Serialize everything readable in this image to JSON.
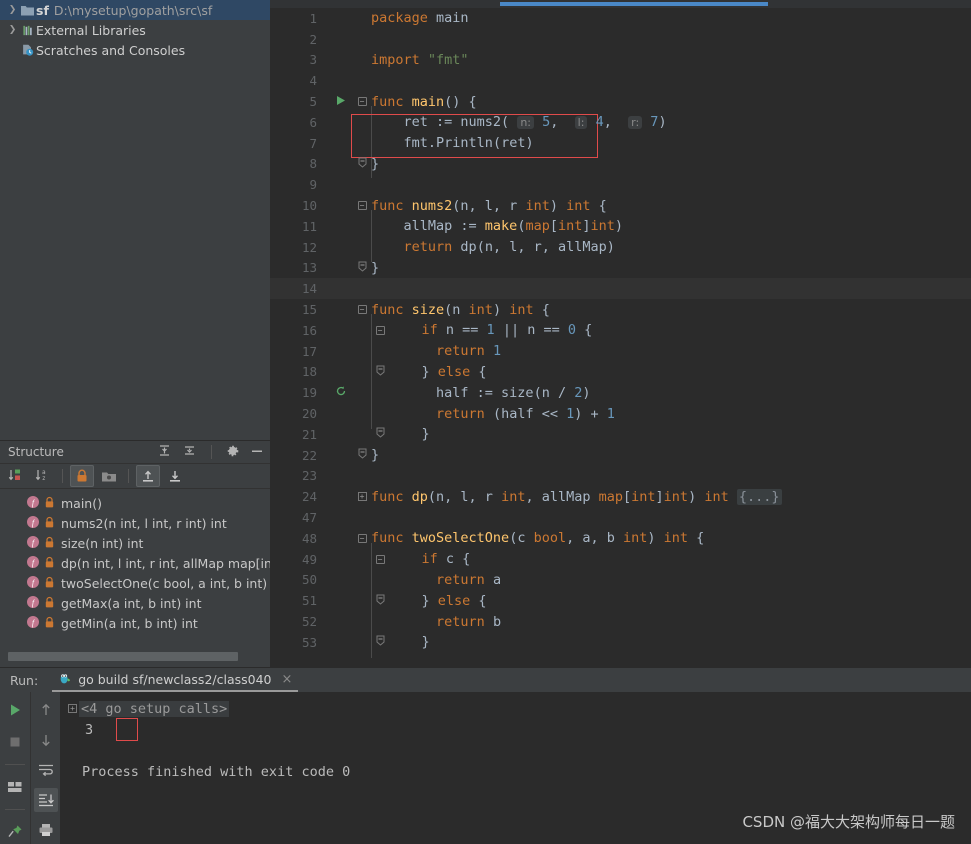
{
  "project": {
    "items": [
      {
        "arrow": "❯",
        "icon": "folder-icon",
        "name": "sf",
        "path": "D:\\mysetup\\gopath\\src\\sf",
        "selected": true
      },
      {
        "arrow": "❯",
        "icon": "library-icon",
        "name": "External Libraries",
        "path": "",
        "selected": false
      },
      {
        "arrow": "",
        "icon": "scratches-icon",
        "name": "Scratches and Consoles",
        "path": "",
        "selected": false
      }
    ]
  },
  "structure": {
    "title": "Structure",
    "header_icons": [
      "expand-all-icon",
      "collapse-all-icon",
      "settings-gear-icon",
      "minimize-icon"
    ],
    "toolbar_icons": [
      "sort-by-visibility-icon",
      "sort-alphabetically-icon",
      "show-non-public-icon",
      "group-by-file-icon",
      "scroll-from-source-icon",
      "scroll-to-source-icon"
    ],
    "items": [
      {
        "text": "main()"
      },
      {
        "text": "nums2(n int, l int, r int) int"
      },
      {
        "text": "size(n int) int"
      },
      {
        "text": "dp(n int, l int, r int, allMap map[int]in"
      },
      {
        "text": "twoSelectOne(c bool, a int, b int) int"
      },
      {
        "text": "getMax(a int, b int) int"
      },
      {
        "text": "getMin(a int, b int) int"
      }
    ]
  },
  "editor": {
    "lines": [
      {
        "num": "1",
        "indent": 0,
        "tokens": [
          {
            "t": "package ",
            "c": "kw"
          },
          {
            "t": "main",
            "c": "pl"
          }
        ]
      },
      {
        "num": "2",
        "indent": 0,
        "tokens": []
      },
      {
        "num": "3",
        "indent": 0,
        "tokens": [
          {
            "t": "import ",
            "c": "kw"
          },
          {
            "t": "\"fmt\"",
            "c": "str"
          }
        ]
      },
      {
        "num": "4",
        "indent": 0,
        "tokens": []
      },
      {
        "num": "5",
        "indent": 0,
        "fold": "minus",
        "run": true,
        "tokens": [
          {
            "t": "func ",
            "c": "kw"
          },
          {
            "t": "main",
            "c": "fn"
          },
          {
            "t": "() {",
            "c": "pl"
          }
        ]
      },
      {
        "num": "6",
        "indent": 1,
        "tokens": [
          {
            "t": "    ret := ",
            "c": "pl"
          },
          {
            "t": "nums2",
            "c": "pl"
          },
          {
            "t": "( ",
            "c": "pl"
          },
          {
            "t": "n:",
            "c": "hint"
          },
          {
            "t": " ",
            "c": "pl"
          },
          {
            "t": "5",
            "c": "num"
          },
          {
            "t": ",  ",
            "c": "pl"
          },
          {
            "t": "l:",
            "c": "hint"
          },
          {
            "t": " ",
            "c": "pl"
          },
          {
            "t": "4",
            "c": "num"
          },
          {
            "t": ",  ",
            "c": "pl"
          },
          {
            "t": "r:",
            "c": "hint"
          },
          {
            "t": " ",
            "c": "pl"
          },
          {
            "t": "7",
            "c": "num"
          },
          {
            "t": ")",
            "c": "pl"
          }
        ]
      },
      {
        "num": "7",
        "indent": 1,
        "tokens": [
          {
            "t": "    fmt.",
            "c": "pl"
          },
          {
            "t": "Println",
            "c": "pl"
          },
          {
            "t": "(ret)",
            "c": "pl"
          }
        ]
      },
      {
        "num": "8",
        "indent": 0,
        "fold": "end",
        "tokens": [
          {
            "t": "}",
            "c": "pl"
          }
        ]
      },
      {
        "num": "9",
        "indent": 0,
        "tokens": []
      },
      {
        "num": "10",
        "indent": 0,
        "fold": "minus",
        "tokens": [
          {
            "t": "func ",
            "c": "kw"
          },
          {
            "t": "nums2",
            "c": "fn"
          },
          {
            "t": "(n, l, r ",
            "c": "pl"
          },
          {
            "t": "int",
            "c": "kw"
          },
          {
            "t": ") ",
            "c": "pl"
          },
          {
            "t": "int",
            "c": "kw"
          },
          {
            "t": " {",
            "c": "pl"
          }
        ]
      },
      {
        "num": "11",
        "indent": 1,
        "tokens": [
          {
            "t": "    allMap := ",
            "c": "pl"
          },
          {
            "t": "make",
            "c": "fn"
          },
          {
            "t": "(",
            "c": "pl"
          },
          {
            "t": "map",
            "c": "kw"
          },
          {
            "t": "[",
            "c": "pl"
          },
          {
            "t": "int",
            "c": "kw"
          },
          {
            "t": "]",
            "c": "pl"
          },
          {
            "t": "int",
            "c": "kw"
          },
          {
            "t": ")",
            "c": "pl"
          }
        ]
      },
      {
        "num": "12",
        "indent": 1,
        "tokens": [
          {
            "t": "    ",
            "c": "pl"
          },
          {
            "t": "return ",
            "c": "kw"
          },
          {
            "t": "dp",
            "c": "pl"
          },
          {
            "t": "(n, l, r, allMap)",
            "c": "pl"
          }
        ]
      },
      {
        "num": "13",
        "indent": 0,
        "fold": "end",
        "tokens": [
          {
            "t": "}",
            "c": "pl"
          }
        ]
      },
      {
        "num": "14",
        "indent": 0,
        "caret": true,
        "tokens": []
      },
      {
        "num": "15",
        "indent": 0,
        "fold": "minus",
        "tokens": [
          {
            "t": "func ",
            "c": "kw"
          },
          {
            "t": "size",
            "c": "fn"
          },
          {
            "t": "(n ",
            "c": "pl"
          },
          {
            "t": "int",
            "c": "kw"
          },
          {
            "t": ") ",
            "c": "pl"
          },
          {
            "t": "int",
            "c": "kw"
          },
          {
            "t": " {",
            "c": "pl"
          }
        ]
      },
      {
        "num": "16",
        "indent": 1,
        "fold": "minus2",
        "tokens": [
          {
            "t": "    ",
            "c": "pl"
          },
          {
            "t": "if ",
            "c": "kw"
          },
          {
            "t": "n == ",
            "c": "pl"
          },
          {
            "t": "1",
            "c": "num"
          },
          {
            "t": " || n == ",
            "c": "pl"
          },
          {
            "t": "0",
            "c": "num"
          },
          {
            "t": " {",
            "c": "pl"
          }
        ]
      },
      {
        "num": "17",
        "indent": 2,
        "tokens": [
          {
            "t": "        ",
            "c": "pl"
          },
          {
            "t": "return ",
            "c": "kw"
          },
          {
            "t": "1",
            "c": "num"
          }
        ]
      },
      {
        "num": "18",
        "indent": 1,
        "fold": "end2",
        "tokens": [
          {
            "t": "    } ",
            "c": "pl"
          },
          {
            "t": "else",
            "c": "kw"
          },
          {
            "t": " {",
            "c": "pl"
          }
        ]
      },
      {
        "num": "19",
        "indent": 2,
        "recursion": true,
        "tokens": [
          {
            "t": "        half := ",
            "c": "pl"
          },
          {
            "t": "size",
            "c": "pl"
          },
          {
            "t": "(n / ",
            "c": "pl"
          },
          {
            "t": "2",
            "c": "num"
          },
          {
            "t": ")",
            "c": "pl"
          }
        ]
      },
      {
        "num": "20",
        "indent": 2,
        "tokens": [
          {
            "t": "        ",
            "c": "pl"
          },
          {
            "t": "return ",
            "c": "kw"
          },
          {
            "t": "(half << ",
            "c": "pl"
          },
          {
            "t": "1",
            "c": "num"
          },
          {
            "t": ") + ",
            "c": "pl"
          },
          {
            "t": "1",
            "c": "num"
          }
        ]
      },
      {
        "num": "21",
        "indent": 1,
        "fold": "end2",
        "tokens": [
          {
            "t": "    }",
            "c": "pl"
          }
        ]
      },
      {
        "num": "22",
        "indent": 0,
        "fold": "end",
        "tokens": [
          {
            "t": "}",
            "c": "pl"
          }
        ]
      },
      {
        "num": "23",
        "indent": 0,
        "tokens": []
      },
      {
        "num": "24",
        "indent": 0,
        "fold": "plus",
        "tokens": [
          {
            "t": "func ",
            "c": "kw"
          },
          {
            "t": "dp",
            "c": "fn"
          },
          {
            "t": "(n, l, r ",
            "c": "pl"
          },
          {
            "t": "int",
            "c": "kw"
          },
          {
            "t": ", allMap ",
            "c": "pl"
          },
          {
            "t": "map",
            "c": "kw"
          },
          {
            "t": "[",
            "c": "pl"
          },
          {
            "t": "int",
            "c": "kw"
          },
          {
            "t": "]",
            "c": "pl"
          },
          {
            "t": "int",
            "c": "kw"
          },
          {
            "t": ") ",
            "c": "pl"
          },
          {
            "t": "int",
            "c": "kw"
          },
          {
            "t": " ",
            "c": "pl"
          },
          {
            "t": "{...}",
            "c": "fold-placeholder"
          }
        ]
      },
      {
        "num": "47",
        "indent": 0,
        "tokens": []
      },
      {
        "num": "48",
        "indent": 0,
        "fold": "minus",
        "tokens": [
          {
            "t": "func ",
            "c": "kw"
          },
          {
            "t": "twoSelectOne",
            "c": "fn"
          },
          {
            "t": "(c ",
            "c": "pl"
          },
          {
            "t": "bool",
            "c": "kw"
          },
          {
            "t": ", a, b ",
            "c": "pl"
          },
          {
            "t": "int",
            "c": "kw"
          },
          {
            "t": ") ",
            "c": "pl"
          },
          {
            "t": "int",
            "c": "kw"
          },
          {
            "t": " {",
            "c": "pl"
          }
        ]
      },
      {
        "num": "49",
        "indent": 1,
        "fold": "minus2",
        "tokens": [
          {
            "t": "    ",
            "c": "pl"
          },
          {
            "t": "if ",
            "c": "kw"
          },
          {
            "t": "c {",
            "c": "pl"
          }
        ]
      },
      {
        "num": "50",
        "indent": 2,
        "tokens": [
          {
            "t": "        ",
            "c": "pl"
          },
          {
            "t": "return ",
            "c": "kw"
          },
          {
            "t": "a",
            "c": "pl"
          }
        ]
      },
      {
        "num": "51",
        "indent": 1,
        "fold": "end2",
        "tokens": [
          {
            "t": "    } ",
            "c": "pl"
          },
          {
            "t": "else",
            "c": "kw"
          },
          {
            "t": " {",
            "c": "pl"
          }
        ]
      },
      {
        "num": "52",
        "indent": 2,
        "tokens": [
          {
            "t": "        ",
            "c": "pl"
          },
          {
            "t": "return ",
            "c": "kw"
          },
          {
            "t": "b",
            "c": "pl"
          }
        ]
      },
      {
        "num": "53",
        "indent": 1,
        "fold": "end2",
        "tokens": [
          {
            "t": "    }",
            "c": "pl"
          }
        ]
      }
    ]
  },
  "run": {
    "label": "Run:",
    "tab_title": "go build sf/newclass2/class040",
    "tab_close": "×",
    "console": [
      {
        "type": "fold",
        "text": "<4 go setup calls>"
      },
      {
        "type": "output",
        "text": "3",
        "highlight": true
      },
      {
        "type": "blank",
        "text": ""
      },
      {
        "type": "plain",
        "text": "Process finished with exit code 0"
      }
    ],
    "toolbar_left": [
      "run-icon",
      "stop-icon",
      "layout-icon",
      "pin-icon"
    ],
    "toolbar_right": [
      "up-arrow-icon",
      "down-arrow-icon",
      "soft-wrap-icon",
      "scroll-to-end-icon",
      "print-icon"
    ]
  },
  "watermark": {
    "text": "CSDN @福大大架构师每日一题"
  },
  "colors": {
    "accent_blue": "#4a88c7",
    "selection": "#2f4864",
    "editor_bg": "#2b2b2b",
    "panel_bg": "#3c3f41",
    "keyword": "#cc7832",
    "function": "#ffc66d",
    "string": "#6a8759",
    "number": "#6897bb",
    "plain": "#a9b7c6",
    "highlight_red": "#e04b4b"
  }
}
